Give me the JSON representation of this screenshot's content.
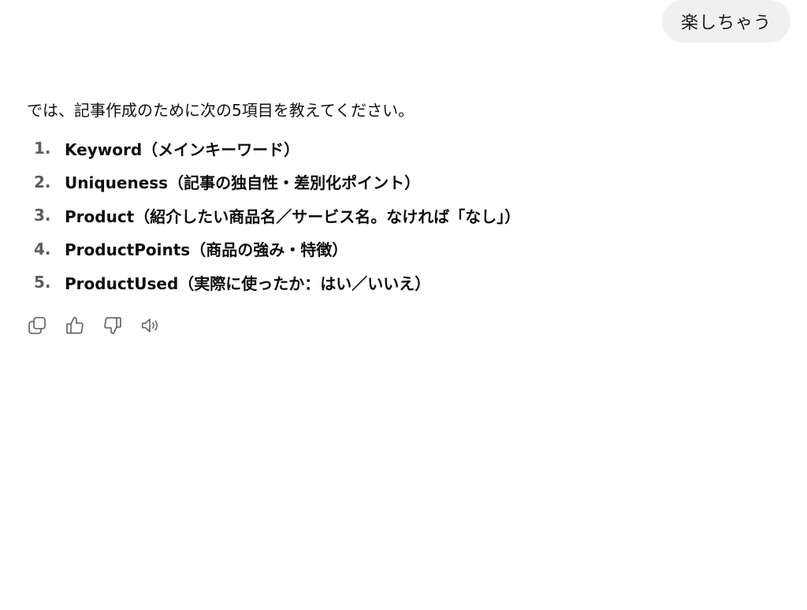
{
  "user_message": "楽しちゃう",
  "assistant": {
    "intro": "では、記事作成のために次の5項目を教えてください。",
    "items": [
      {
        "num": "1.",
        "text": "Keyword（メインキーワード）"
      },
      {
        "num": "2.",
        "text": "Uniqueness（記事の独自性・差別化ポイント）"
      },
      {
        "num": "3.",
        "text": "Product（紹介したい商品名／サービス名。なければ「なし」）"
      },
      {
        "num": "4.",
        "text": "ProductPoints（商品の強み・特徴）"
      },
      {
        "num": "5.",
        "text": "ProductUsed（実際に使ったか：はい／いいえ）"
      }
    ]
  },
  "actions": [
    "copy-icon",
    "thumbs-up-icon",
    "thumbs-down-icon",
    "read-aloud-icon"
  ],
  "colors": {
    "bubble_bg": "#f0f0f0",
    "text": "#0d0d0d",
    "muted": "#5d5d5d"
  }
}
